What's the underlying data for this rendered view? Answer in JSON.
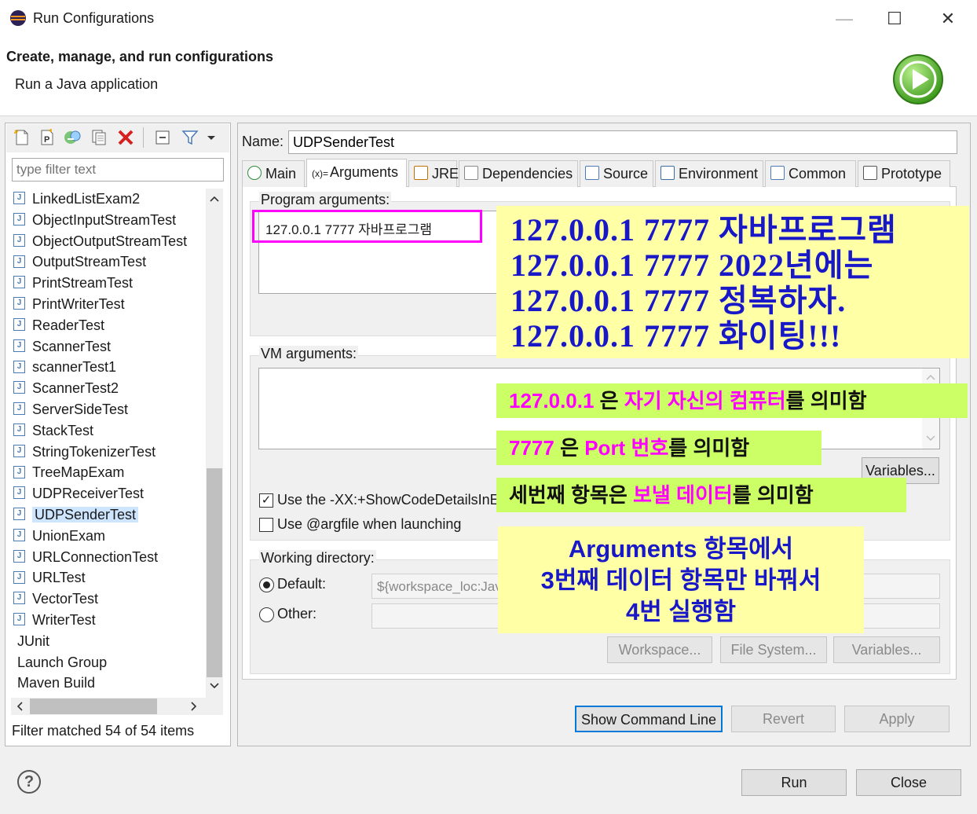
{
  "window": {
    "title": "Run Configurations",
    "minimize": "—",
    "maximize": "☐",
    "close": "✕"
  },
  "banner": {
    "title": "Create, manage, and run configurations",
    "subtitle": "Run a Java application"
  },
  "left": {
    "filter_placeholder": "type filter text",
    "items": [
      {
        "label": "LinkedListExam2",
        "type": "java"
      },
      {
        "label": "ObjectInputStreamTest",
        "type": "java"
      },
      {
        "label": "ObjectOutputStreamTest",
        "type": "java"
      },
      {
        "label": "OutputStreamTest",
        "type": "java"
      },
      {
        "label": "PrintStreamTest",
        "type": "java"
      },
      {
        "label": "PrintWriterTest",
        "type": "java"
      },
      {
        "label": "ReaderTest",
        "type": "java"
      },
      {
        "label": "ScannerTest",
        "type": "java"
      },
      {
        "label": "scannerTest1",
        "type": "java"
      },
      {
        "label": "ScannerTest2",
        "type": "java"
      },
      {
        "label": "ServerSideTest",
        "type": "java"
      },
      {
        "label": "StackTest",
        "type": "java"
      },
      {
        "label": "StringTokenizerTest",
        "type": "java"
      },
      {
        "label": "TreeMapExam",
        "type": "java"
      },
      {
        "label": "UDPReceiverTest",
        "type": "java"
      },
      {
        "label": "UDPSenderTest",
        "type": "java",
        "selected": true
      },
      {
        "label": "UnionExam",
        "type": "java"
      },
      {
        "label": "URLConnectionTest",
        "type": "java"
      },
      {
        "label": "URLTest",
        "type": "java"
      },
      {
        "label": "VectorTest",
        "type": "java"
      },
      {
        "label": "WriterTest",
        "type": "java"
      },
      {
        "label": "JUnit",
        "type": "category"
      },
      {
        "label": "Launch Group",
        "type": "category"
      },
      {
        "label": "Maven Build",
        "type": "category"
      }
    ],
    "status": "Filter matched 54 of 54 items"
  },
  "config": {
    "name_label": "Name:",
    "name_value": "UDPSenderTest",
    "tabs": [
      {
        "label": "Main",
        "icon": "main-tab-icon"
      },
      {
        "label": "Arguments",
        "icon": "arguments-tab-icon",
        "active": true
      },
      {
        "label": "JRE",
        "icon": "jre-tab-icon"
      },
      {
        "label": "Dependencies",
        "icon": "dependencies-tab-icon"
      },
      {
        "label": "Source",
        "icon": "source-tab-icon"
      },
      {
        "label": "Environment",
        "icon": "environment-tab-icon"
      },
      {
        "label": "Common",
        "icon": "common-tab-icon"
      },
      {
        "label": "Prototype",
        "icon": "prototype-tab-icon"
      }
    ],
    "arguments_tab_prefix": "(x)=",
    "program_args_label": "Program arguments:",
    "program_args_value": "127.0.0.1  7777  자바프로그램",
    "vm_args_label": "VM arguments:",
    "variables_label": "Variables...",
    "use_xx_label": "Use the -XX:+ShowCodeDetailsInEx",
    "use_xx_checked": true,
    "use_argfile_label": "Use @argfile when launching",
    "use_argfile_checked": false,
    "working_dir_label": "Working directory:",
    "default_label": "Default:",
    "default_value": "${workspace_loc:Jav",
    "other_label": "Other:",
    "workspace_btn": "Workspace...",
    "filesystem_btn": "File System...",
    "variables2_btn": "Variables...",
    "show_cmd_btn": "Show Command Line",
    "revert_btn": "Revert",
    "apply_btn": "Apply"
  },
  "footer": {
    "help": "?",
    "run_btn": "Run",
    "close_btn": "Close"
  },
  "annotations": {
    "big_lines": [
      "127.0.0.1  7777  자바프로그램",
      "127.0.0.1  7777  2022년에는",
      "127.0.0.1  7777  정복하자.",
      "127.0.0.1  7777  화이팅!!!"
    ],
    "note1_a": "127.0.0.1",
    "note1_b": " 은 ",
    "note1_c": "자기 자신의 컴퓨터",
    "note1_d": "를 의미함",
    "note2_a": "7777",
    "note2_b": " 은 ",
    "note2_c": "Port 번호",
    "note2_d": "를 의미함",
    "note3_a": "세번째 항목은 ",
    "note3_c": "보낼 데이터",
    "note3_d": "를 의미함",
    "summary_lines": [
      "Arguments 항목에서",
      "3번째 데이터 항목만 바꿔서",
      "4번 실행함"
    ],
    "colors": {
      "note_yellow": "#ffffa6",
      "note_green": "#ccff66",
      "blue_text": "#1818c8",
      "magenta": "#ff00ff"
    }
  }
}
